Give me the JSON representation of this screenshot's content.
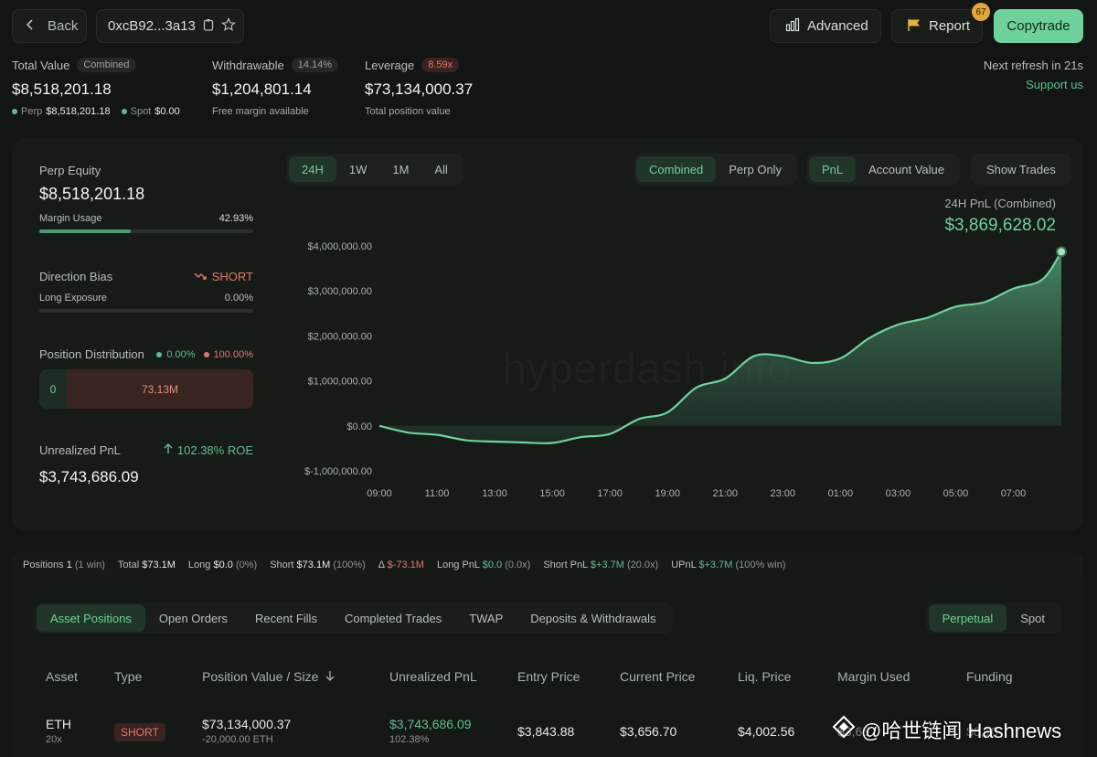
{
  "header": {
    "back_label": "Back",
    "address": "0xcB92...3a13",
    "advanced_label": "Advanced",
    "report_label": "Report",
    "report_badge": "67",
    "copytrade_label": "Copytrade"
  },
  "summary": {
    "total_value": {
      "label": "Total Value",
      "pill": "Combined",
      "value": "$8,518,201.18",
      "perp_label": "Perp",
      "perp_value": "$8,518,201.18",
      "spot_label": "Spot",
      "spot_value": "$0.00"
    },
    "withdrawable": {
      "label": "Withdrawable",
      "pill": "14.14%",
      "value": "$1,204,801.14",
      "sub": "Free margin available"
    },
    "leverage": {
      "label": "Leverage",
      "pill": "8.59x",
      "value": "$73,134,000.37",
      "sub": "Total position value"
    },
    "refresh": "Next refresh in 21s",
    "support": "Support us"
  },
  "left_panel": {
    "perp_equity_label": "Perp Equity",
    "perp_equity_value": "$8,518,201.18",
    "margin_usage_label": "Margin Usage",
    "margin_usage_value": "42.93%",
    "margin_usage_fraction": 0.4293,
    "direction_bias_label": "Direction Bias",
    "direction_bias_value": "SHORT",
    "long_exposure_label": "Long Exposure",
    "long_exposure_value": "0.00%",
    "position_distribution_label": "Position Distribution",
    "dist_long_pct": "0.00%",
    "dist_short_pct": "100.00%",
    "dist_long_value": "0",
    "dist_short_value": "73.13M",
    "unrealized_pnl_label": "Unrealized PnL",
    "roe": "102.38% ROE",
    "unrealized_pnl_value": "$3,743,686.09"
  },
  "chart_controls": {
    "ranges": [
      "24H",
      "1W",
      "1M",
      "All"
    ],
    "active_range": "24H",
    "modes": [
      "Combined",
      "Perp Only"
    ],
    "active_mode": "Combined",
    "metrics": [
      "PnL",
      "Account Value"
    ],
    "active_metric": "PnL",
    "show_trades": "Show Trades"
  },
  "chart_title": "24H PnL (Combined)",
  "chart_value": "$3,869,628.02",
  "watermark": "hyperdash.info",
  "colors": {
    "accent": "#6fd19b",
    "negative": "#e07a6b",
    "background": "#121513"
  },
  "chart_data": {
    "type": "area",
    "title": "24H PnL (Combined)",
    "x": [
      "09:00",
      "10:00",
      "11:00",
      "12:00",
      "13:00",
      "14:00",
      "15:00",
      "16:00",
      "17:00",
      "18:00",
      "19:00",
      "20:00",
      "21:00",
      "22:00",
      "23:00",
      "00:00",
      "01:00",
      "02:00",
      "03:00",
      "04:00",
      "05:00",
      "06:00",
      "07:00",
      "08:00",
      "08:40"
    ],
    "xticks": [
      "09:00",
      "11:00",
      "13:00",
      "15:00",
      "17:00",
      "19:00",
      "21:00",
      "23:00",
      "01:00",
      "03:00",
      "05:00",
      "07:00"
    ],
    "yticks": [
      "$4,000,000.00",
      "$3,000,000.00",
      "$2,000,000.00",
      "$1,000,000.00",
      "$0.00",
      "$-1,000,000.00"
    ],
    "values": [
      0,
      -150000,
      -200000,
      -320000,
      -350000,
      -370000,
      -380000,
      -250000,
      -180000,
      150000,
      300000,
      850000,
      1050000,
      1550000,
      1550000,
      1400000,
      1500000,
      1950000,
      2250000,
      2400000,
      2650000,
      2750000,
      3050000,
      3250000,
      3869628
    ],
    "ylim": [
      -1000000,
      4000000
    ]
  },
  "stats_strip": {
    "positions_label": "Positions",
    "positions_value": "1",
    "positions_note": "(1 win)",
    "total_label": "Total",
    "total_value": "$73.1M",
    "long_label": "Long",
    "long_value": "$0.0",
    "long_note": "(0%)",
    "short_label": "Short",
    "short_value": "$73.1M",
    "short_note": "(100%)",
    "delta_label": "Δ",
    "delta_value": "$-73.1M",
    "longpnl_label": "Long PnL",
    "longpnl_value": "$0.0",
    "longpnl_note": "(0.0x)",
    "shortpnl_label": "Short PnL",
    "shortpnl_value": "$+3.7M",
    "shortpnl_note": "(20.0x)",
    "upnl_label": "UPnL",
    "upnl_value": "$+3.7M",
    "upnl_note": "(100% win)"
  },
  "tabs": [
    "Asset Positions",
    "Open Orders",
    "Recent Fills",
    "Completed Trades",
    "TWAP",
    "Deposits & Withdrawals"
  ],
  "active_tab": "Asset Positions",
  "market_tabs": [
    "Perpetual",
    "Spot"
  ],
  "active_market_tab": "Perpetual",
  "table": {
    "headers": [
      "Asset",
      "Type",
      "Position Value / Size",
      "Unrealized PnL",
      "Entry Price",
      "Current Price",
      "Liq. Price",
      "Margin Used",
      "Funding"
    ],
    "rows": [
      {
        "asset": "ETH",
        "leverage": "20x",
        "type": "SHORT",
        "value": "$73,134,000.37",
        "size": "-20,000.00 ETH",
        "pnl": "$3,743,686.09",
        "pnl_pct": "102.38%",
        "entry": "$3,843.88",
        "current": "$3,656.70",
        "liq": "$4,002.56",
        "margin": "$3,65",
        "funding": "$0,10"
      }
    ]
  },
  "bottom_watermark": "@哈世链闻 Hashnews"
}
